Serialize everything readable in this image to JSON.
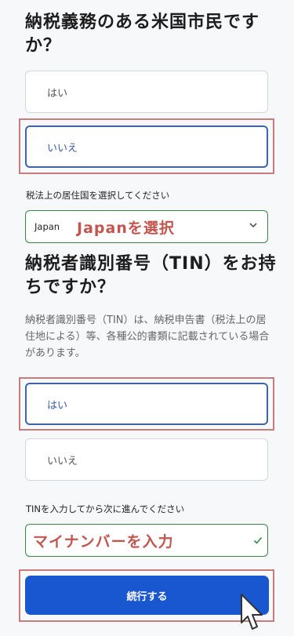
{
  "q1": {
    "title": "納税義務のある米国市民ですか？",
    "options": [
      "はい",
      "いいえ"
    ]
  },
  "residence": {
    "label": "税法上の居住国を選択してください",
    "value": "Japan",
    "annotation": "Japanを選択"
  },
  "q2": {
    "title": "納税者識別番号（TIN）をお持ちですか？",
    "description": "納税者識別番号（TIN）は、納税申告書（税法上の居住地による）等、各種公的書類に記載されている場合があります。",
    "options": [
      "はい",
      "いいえ"
    ]
  },
  "tin": {
    "label": "TINを入力してから次に進んでください",
    "annotation": "マイナンバーを入力"
  },
  "continue_label": "続行する",
  "colors": {
    "primary": "#1957d1",
    "highlight": "#c97a7a",
    "annotation": "#c2564e",
    "valid": "#2f8a47"
  }
}
